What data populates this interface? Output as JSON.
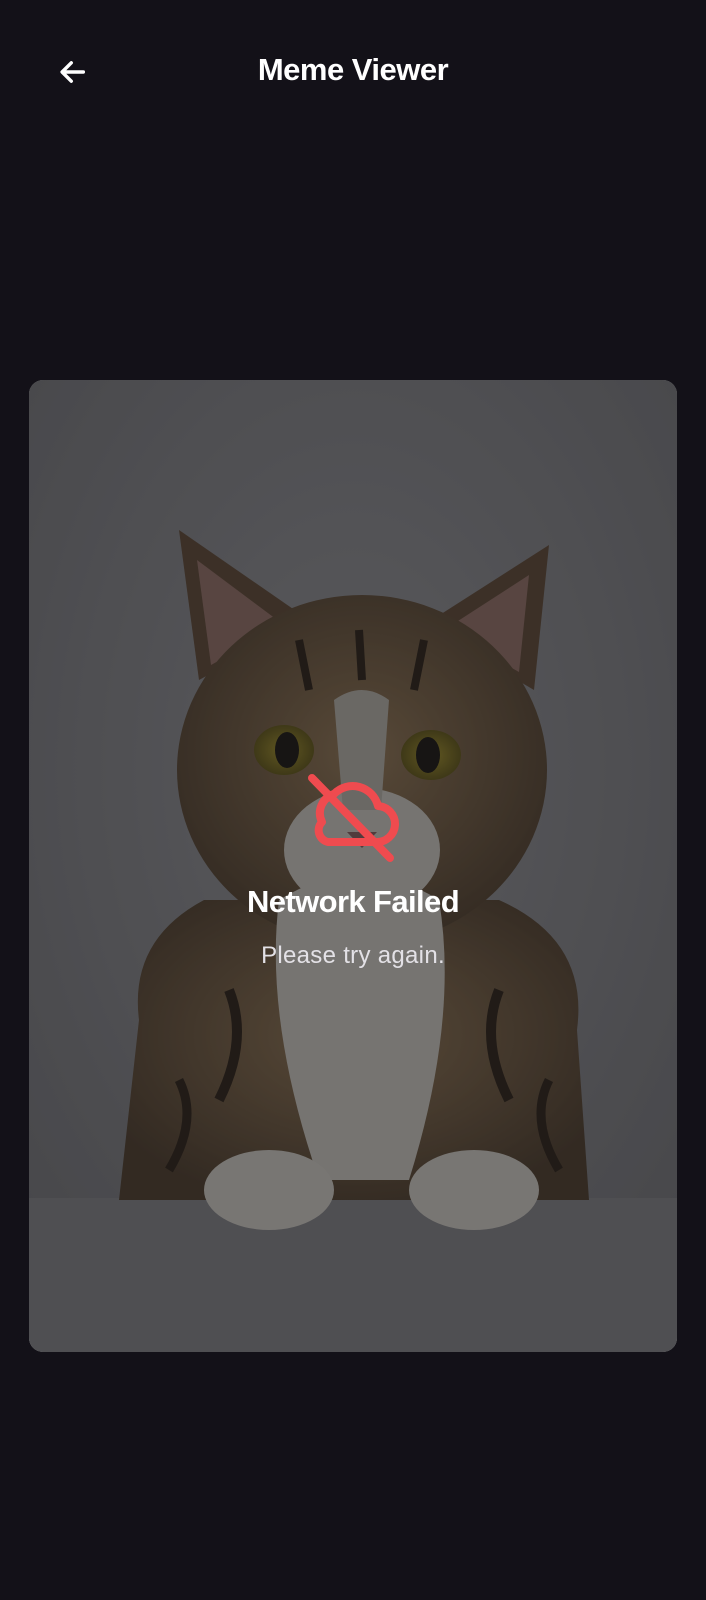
{
  "header": {
    "title": "Meme Viewer"
  },
  "icons": {
    "back": "arrow-left-icon",
    "error": "cloud-off-icon"
  },
  "error": {
    "title": "Network Failed",
    "message": "Please try again."
  },
  "colors": {
    "background": "#131118",
    "text_primary": "#ffffff",
    "error_accent": "#ef4b4f"
  }
}
